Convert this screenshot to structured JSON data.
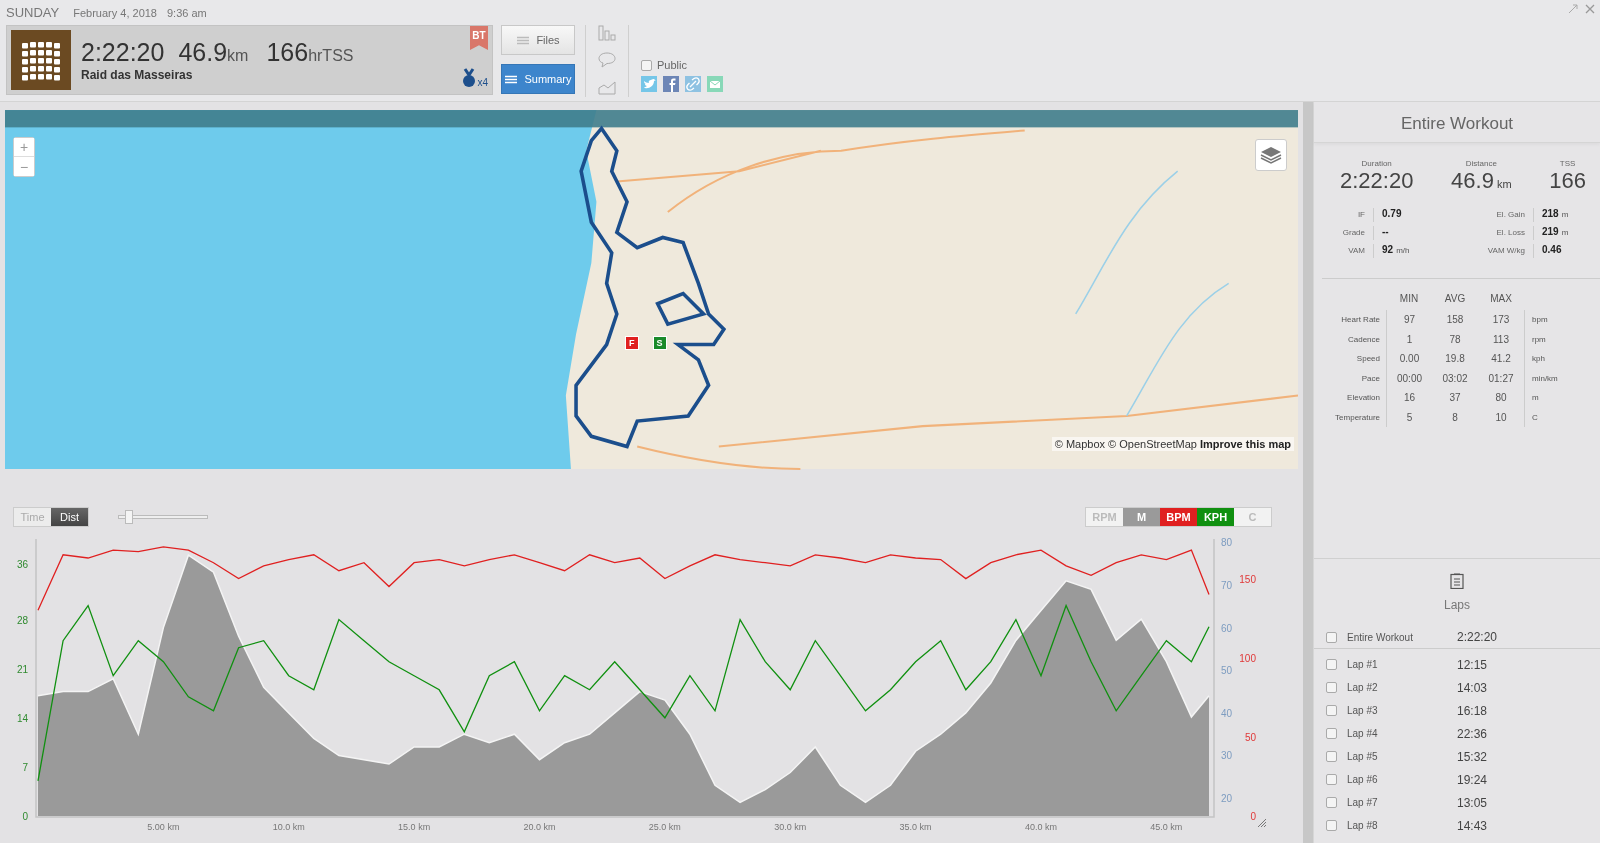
{
  "header": {
    "day": "SUNDAY",
    "date": "February 4, 2018",
    "time": "9:36 am"
  },
  "workout_card": {
    "duration": "2:22:20",
    "distance": "46.9",
    "distance_unit": "km",
    "tss": "166",
    "tss_unit": "hrTSS",
    "title": "Raid das Masseiras",
    "badge": "BT",
    "medal_count": "x4"
  },
  "view_buttons": [
    {
      "label": "Files",
      "selected": false
    },
    {
      "label": "Summary",
      "selected": true
    }
  ],
  "public": {
    "label": "Public",
    "checked": false
  },
  "map": {
    "markers": [
      {
        "label": "F",
        "color": "#e02020"
      },
      {
        "label": "S",
        "color": "#1a8a2a"
      }
    ],
    "zoom_in": "+",
    "zoom_out": "−",
    "attribution": "© Mapbox © OpenStreetMap",
    "improve_link": "Improve this map"
  },
  "axis_toggle": [
    {
      "label": "Time",
      "selected": false
    },
    {
      "label": "Dist",
      "selected": true
    }
  ],
  "zoom_slider": {
    "level": 0.13
  },
  "series_toggles": [
    {
      "kind": "plain",
      "label": "RPM",
      "on": false
    },
    {
      "kind": "series",
      "on": true
    },
    {
      "kind": "series",
      "on": true
    },
    {
      "kind": "series",
      "on": true
    },
    {
      "kind": "plain",
      "label": "C",
      "on": false
    }
  ],
  "chart_data": {
    "type": "line",
    "x": [
      0,
      1,
      2,
      3,
      4,
      5,
      6,
      7,
      8,
      9,
      10,
      11,
      12,
      13,
      14,
      15,
      16,
      17,
      18,
      19,
      20,
      21,
      22,
      23,
      24,
      25,
      26,
      27,
      28,
      29,
      30,
      31,
      32,
      33,
      34,
      35,
      36,
      37,
      38,
      39,
      40,
      41,
      42,
      43,
      44,
      45,
      46,
      46.7
    ],
    "xlim": [
      0,
      46.9
    ],
    "ylim": [
      0,
      39.5
    ],
    "xticks": [
      {
        "value": 5,
        "label": "5.00 km"
      },
      {
        "value": 10,
        "label": "10.0 km"
      },
      {
        "value": 15,
        "label": "15.0 km"
      },
      {
        "value": 20,
        "label": "20.0 km"
      },
      {
        "value": 25,
        "label": "25.0 km"
      },
      {
        "value": 30,
        "label": "30.0 km"
      },
      {
        "value": 35,
        "label": "35.0 km"
      },
      {
        "value": 40,
        "label": "40.0 km"
      },
      {
        "value": 45,
        "label": "45.0 km"
      }
    ],
    "yticks": [
      0,
      7,
      14,
      21,
      28,
      36
    ],
    "y2lim": [
      15.8,
      80.8
    ],
    "y2ticks": [
      20,
      30,
      40,
      50,
      60,
      70,
      80
    ],
    "y3lim": [
      0,
      175
    ],
    "y3ticks": [
      0,
      50,
      100,
      150
    ],
    "series": [
      {
        "name": "M",
        "color": "#9a9a9a",
        "axis": "y2",
        "type": "area",
        "values": [
          44,
          45,
          45,
          48,
          35,
          60,
          77,
          73,
          58,
          46,
          40,
          34,
          30,
          29,
          28,
          32,
          32,
          35,
          33,
          35,
          29,
          33,
          35,
          40,
          45,
          43,
          35,
          23,
          19,
          22,
          26,
          32,
          23,
          19,
          23,
          31,
          35,
          40,
          47,
          57,
          64,
          71,
          69,
          57,
          62,
          52,
          39,
          44
        ]
      },
      {
        "name": "BPM",
        "color": "#e02020",
        "axis": "y3",
        "values": [
          130,
          165,
          163,
          168,
          167,
          170,
          168,
          160,
          150,
          158,
          162,
          165,
          155,
          160,
          145,
          160,
          162,
          158,
          162,
          165,
          160,
          155,
          165,
          160,
          163,
          150,
          158,
          165,
          162,
          160,
          158,
          165,
          163,
          160,
          165,
          163,
          162,
          150,
          160,
          165,
          168,
          158,
          152,
          160,
          165,
          162,
          168,
          140
        ]
      },
      {
        "name": "KPH",
        "color": "#109010",
        "axis": "y",
        "values": [
          5,
          25,
          30,
          20,
          25,
          22,
          17,
          15,
          24,
          25,
          20,
          18,
          28,
          25,
          22,
          20,
          18,
          12,
          20,
          22,
          15,
          20,
          18,
          22,
          18,
          14,
          20,
          15,
          28,
          22,
          18,
          25,
          20,
          15,
          18,
          22,
          25,
          18,
          22,
          28,
          20,
          30,
          22,
          15,
          20,
          25,
          22,
          27
        ]
      }
    ]
  },
  "panel": {
    "title": "Entire Workout",
    "summary": [
      {
        "label": "Duration",
        "value": "2:22:20"
      },
      {
        "label": "Distance",
        "value": "46.9",
        "unit": "km"
      },
      {
        "label": "TSS",
        "value": "166"
      }
    ],
    "metrics_left": [
      {
        "label": "IF",
        "value": "0.79"
      },
      {
        "label": "Grade",
        "value": "--"
      },
      {
        "label": "VAM",
        "value": "92",
        "unit": "m/h"
      }
    ],
    "metrics_right": [
      {
        "label": "El. Gain",
        "value": "218",
        "unit": "m"
      },
      {
        "label": "El. Loss",
        "value": "219",
        "unit": "m"
      },
      {
        "label": "VAM W/kg",
        "value": "0.46"
      }
    ],
    "table": {
      "columns": [
        "MIN",
        "AVG",
        "MAX"
      ],
      "rows": [
        {
          "label": "Heart Rate",
          "min": "97",
          "avg": "158",
          "max": "173",
          "unit": "bpm"
        },
        {
          "label": "Cadence",
          "min": "1",
          "avg": "78",
          "max": "113",
          "unit": "rpm"
        },
        {
          "label": "Speed",
          "min": "0.00",
          "avg": "19.8",
          "max": "41.2",
          "unit": "kph"
        },
        {
          "label": "Pace",
          "min": "00:00",
          "avg": "03:02",
          "max": "01:27",
          "unit": "min/km"
        },
        {
          "label": "Elevation",
          "min": "16",
          "avg": "37",
          "max": "80",
          "unit": "m"
        },
        {
          "label": "Temperature",
          "min": "5",
          "avg": "8",
          "max": "10",
          "unit": "C"
        }
      ]
    }
  },
  "laps": {
    "title": "Laps",
    "entire": {
      "label": "Entire Workout",
      "time": "2:22:20",
      "checked": false
    },
    "items": [
      {
        "label": "Lap #1",
        "time": "12:15",
        "checked": false
      },
      {
        "label": "Lap #2",
        "time": "14:03",
        "checked": false
      },
      {
        "label": "Lap #3",
        "time": "16:18",
        "checked": false
      },
      {
        "label": "Lap #4",
        "time": "22:36",
        "checked": false
      },
      {
        "label": "Lap #5",
        "time": "15:32",
        "checked": false
      },
      {
        "label": "Lap #6",
        "time": "19:24",
        "checked": false
      },
      {
        "label": "Lap #7",
        "time": "13:05",
        "checked": false
      },
      {
        "label": "Lap #8",
        "time": "14:43",
        "checked": false
      }
    ]
  }
}
